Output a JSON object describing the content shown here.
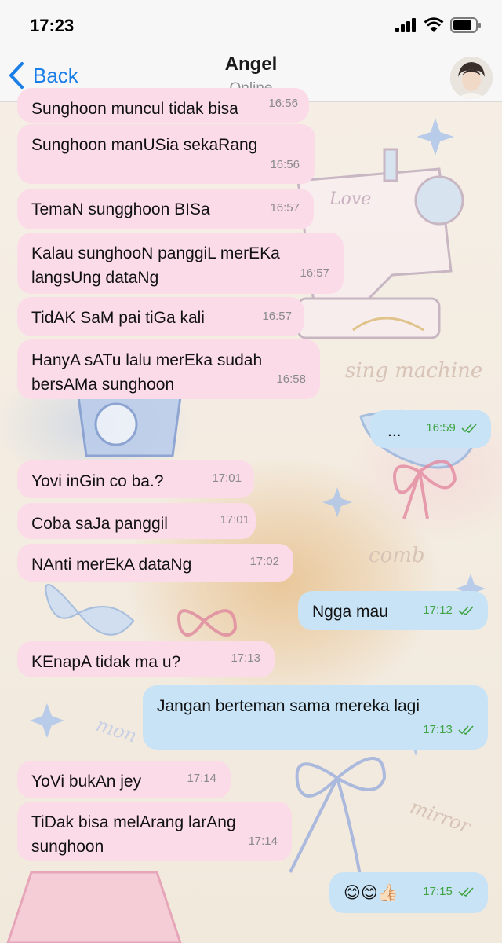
{
  "status_bar": {
    "time": "17:23"
  },
  "header": {
    "back_label": "Back",
    "title": "Angel",
    "subtitle": "Online"
  },
  "messages": [
    {
      "dir": "in",
      "text": "Sunghoon muncul tidak bisa",
      "time": "16:56"
    },
    {
      "dir": "in",
      "text": "Sunghoon manUSia sekaRang",
      "time": "16:56"
    },
    {
      "dir": "in",
      "text": "TemaN sungghoon BISa",
      "time": "16:57"
    },
    {
      "dir": "in",
      "text": "Kalau sunghooN panggiL merEKa\nlangsUng dataNg",
      "time": "16:57"
    },
    {
      "dir": "in",
      "text": "TidAK SaM pai tiGa kali",
      "time": "16:57"
    },
    {
      "dir": "in",
      "text": "HanyA sATu lalu merEka sudah\nbersAMa sunghoon",
      "time": "16:58"
    },
    {
      "dir": "out",
      "text": "...",
      "time": "16:59",
      "read": true
    },
    {
      "dir": "in",
      "text": "Yovi inGin co ba.?",
      "time": "17:01"
    },
    {
      "dir": "in",
      "text": "Coba saJa panggil",
      "time": "17:01"
    },
    {
      "dir": "in",
      "text": "NAnti merEkA dataNg",
      "time": "17:02"
    },
    {
      "dir": "out",
      "text": "Ngga mau",
      "time": "17:12",
      "read": true
    },
    {
      "dir": "in",
      "text": "KEnapA tidak ma u?",
      "time": "17:13"
    },
    {
      "dir": "out",
      "text": "Jangan berteman sama mereka lagi",
      "time": "17:13",
      "read": true
    },
    {
      "dir": "in",
      "text": "YoVi bukAn jey",
      "time": "17:14"
    },
    {
      "dir": "in",
      "text": "TiDak bisa melArang larAng\nsunghoon",
      "time": "17:14"
    },
    {
      "dir": "out",
      "text": "😊😊👍🏻",
      "time": "17:15",
      "read": true
    }
  ],
  "colors": {
    "incoming_bubble": "#fbdbe8",
    "outgoing_bubble": "#c8e3f6",
    "accent": "#1a7ee8",
    "read_ticks": "#3fa343"
  },
  "icons": [
    "back-chevron-icon",
    "signal-icon",
    "wifi-icon",
    "battery-icon",
    "read-ticks-icon",
    "avatar"
  ]
}
